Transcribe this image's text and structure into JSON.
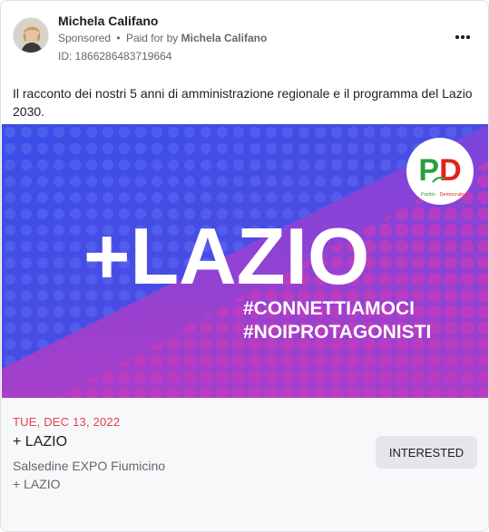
{
  "post": {
    "author_name": "Michela Califano",
    "sponsored_label": "Sponsored",
    "separator": "•",
    "paid_for_prefix": "Paid for by",
    "paid_for_name": "Michela Califano",
    "ad_id": "ID: 1866286483719664",
    "body_text": "Il racconto dei nostri 5 anni di amministrazione regionale e il programma del Lazio 2030.",
    "more_icon": "more-horizontal-icon"
  },
  "creative": {
    "headline": "+LAZIO",
    "hashtag_1": "#CONNETTIAMOCI",
    "hashtag_2": "#NOIPROTAGONISTI",
    "logo_text": "PD",
    "logo_caption_left": "Partito",
    "logo_caption_right": "Democratico",
    "colors": {
      "background_blue": "#3c52e6",
      "background_purple": "#8f3fd0",
      "dots_magenta": "#c13bbd",
      "text": "#ffffff",
      "logo_green": "#2e9e3f",
      "logo_red": "#e2231a"
    }
  },
  "event": {
    "date": "TUE, DEC 13, 2022",
    "title": "+ LAZIO",
    "location": "Salsedine EXPO Fiumicino",
    "location_detail": "+ LAZIO",
    "cta_label": "INTERESTED"
  }
}
